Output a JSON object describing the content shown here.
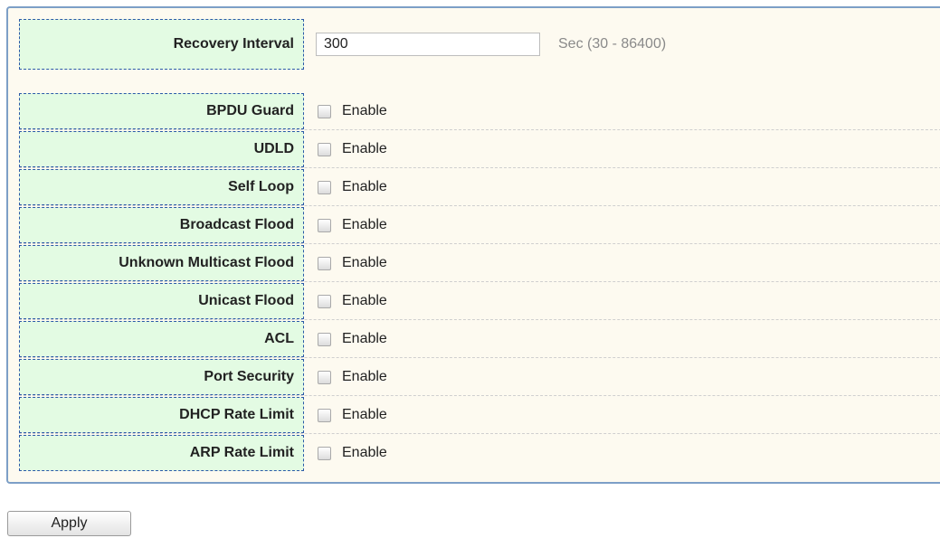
{
  "form": {
    "recovery_interval": {
      "label": "Recovery Interval",
      "value": "300",
      "hint": "Sec (30 - 86400)"
    },
    "enable_label": "Enable",
    "rows": [
      {
        "label": "BPDU Guard",
        "checked": false
      },
      {
        "label": "UDLD",
        "checked": false
      },
      {
        "label": "Self Loop",
        "checked": false
      },
      {
        "label": "Broadcast Flood",
        "checked": false
      },
      {
        "label": "Unknown Multicast Flood",
        "checked": false
      },
      {
        "label": "Unicast Flood",
        "checked": false
      },
      {
        "label": "ACL",
        "checked": false
      },
      {
        "label": "Port Security",
        "checked": false
      },
      {
        "label": "DHCP Rate Limit",
        "checked": false
      },
      {
        "label": "ARP Rate Limit",
        "checked": false
      }
    ]
  },
  "actions": {
    "apply_label": "Apply"
  }
}
